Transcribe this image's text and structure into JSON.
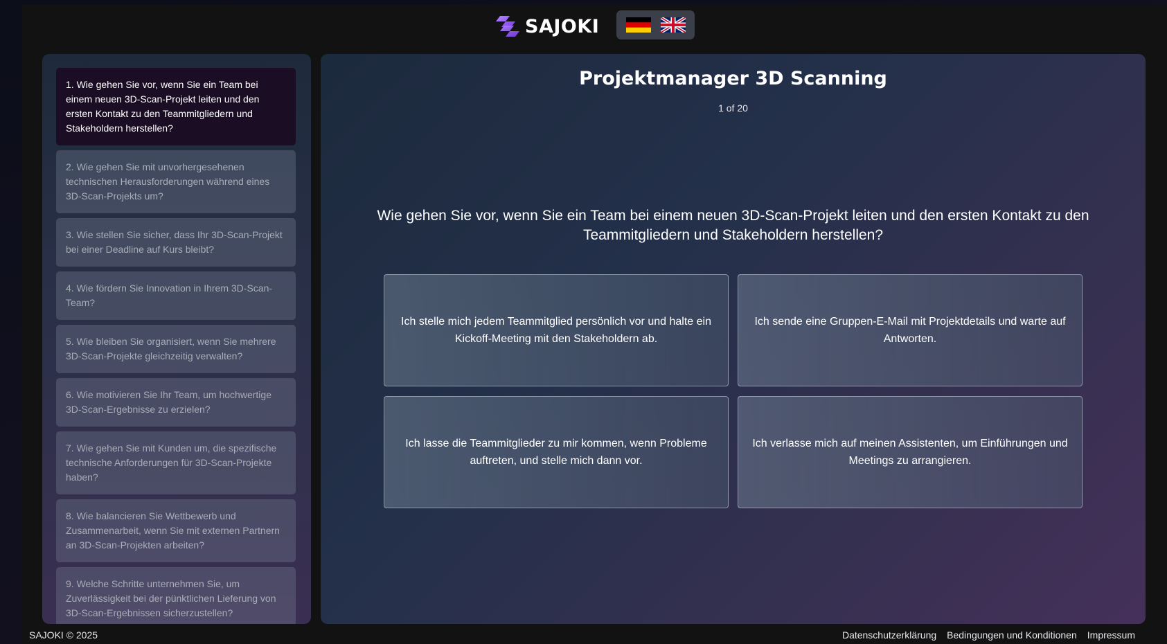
{
  "brand": {
    "name": "SAJOKI",
    "accent": "#8b5cf6"
  },
  "languages": [
    {
      "code": "de",
      "icon": "german-flag-icon"
    },
    {
      "code": "en",
      "icon": "uk-flag-icon"
    }
  ],
  "sidebar": {
    "items": [
      {
        "label": "1. Wie gehen Sie vor, wenn Sie ein Team bei einem neuen 3D-Scan-Projekt leiten und den ersten Kontakt zu den Teammitgliedern und Stakeholdern herstellen?",
        "active": true
      },
      {
        "label": "2. Wie gehen Sie mit unvorhergesehenen technischen Herausforderungen während eines 3D-Scan-Projekts um?"
      },
      {
        "label": "3. Wie stellen Sie sicher, dass Ihr 3D-Scan-Projekt bei einer Deadline auf Kurs bleibt?"
      },
      {
        "label": "4. Wie fördern Sie Innovation in Ihrem 3D-Scan-Team?"
      },
      {
        "label": "5. Wie bleiben Sie organisiert, wenn Sie mehrere 3D-Scan-Projekte gleichzeitig verwalten?"
      },
      {
        "label": "6. Wie motivieren Sie Ihr Team, um hochwertige 3D-Scan-Ergebnisse zu erzielen?"
      },
      {
        "label": "7. Wie gehen Sie mit Kunden um, die spezifische technische Anforderungen für 3D-Scan-Projekte haben?"
      },
      {
        "label": "8. Wie balancieren Sie Wettbewerb und Zusammenarbeit, wenn Sie mit externen Partnern an 3D-Scan-Projekten arbeiten?"
      },
      {
        "label": "9. Welche Schritte unternehmen Sie, um Zuverlässigkeit bei der pünktlichen Lieferung von 3D-Scan-Ergebnissen sicherzustellen?"
      }
    ]
  },
  "main": {
    "title": "Projektmanager 3D Scanning",
    "counter": "1 of 20",
    "question": "Wie gehen Sie vor, wenn Sie ein Team bei einem neuen 3D-Scan-Projekt leiten und den ersten Kontakt zu den Teammitgliedern und Stakeholdern herstellen?",
    "answers": [
      "Ich stelle mich jedem Teammitglied persönlich vor und halte ein Kickoff-Meeting mit den Stakeholdern ab.",
      "Ich sende eine Gruppen-E-Mail mit Projektdetails und warte auf Antworten.",
      "Ich lasse die Teammitglieder zu mir kommen, wenn Probleme auftreten, und stelle mich dann vor.",
      "Ich verlasse mich auf meinen Assistenten, um Einführungen und Meetings zu arrangieren."
    ]
  },
  "footer": {
    "copyright": "SAJOKI © 2025",
    "links": [
      "Datenschutzerklärung",
      "Bedingungen und Konditionen",
      "Impressum"
    ]
  }
}
